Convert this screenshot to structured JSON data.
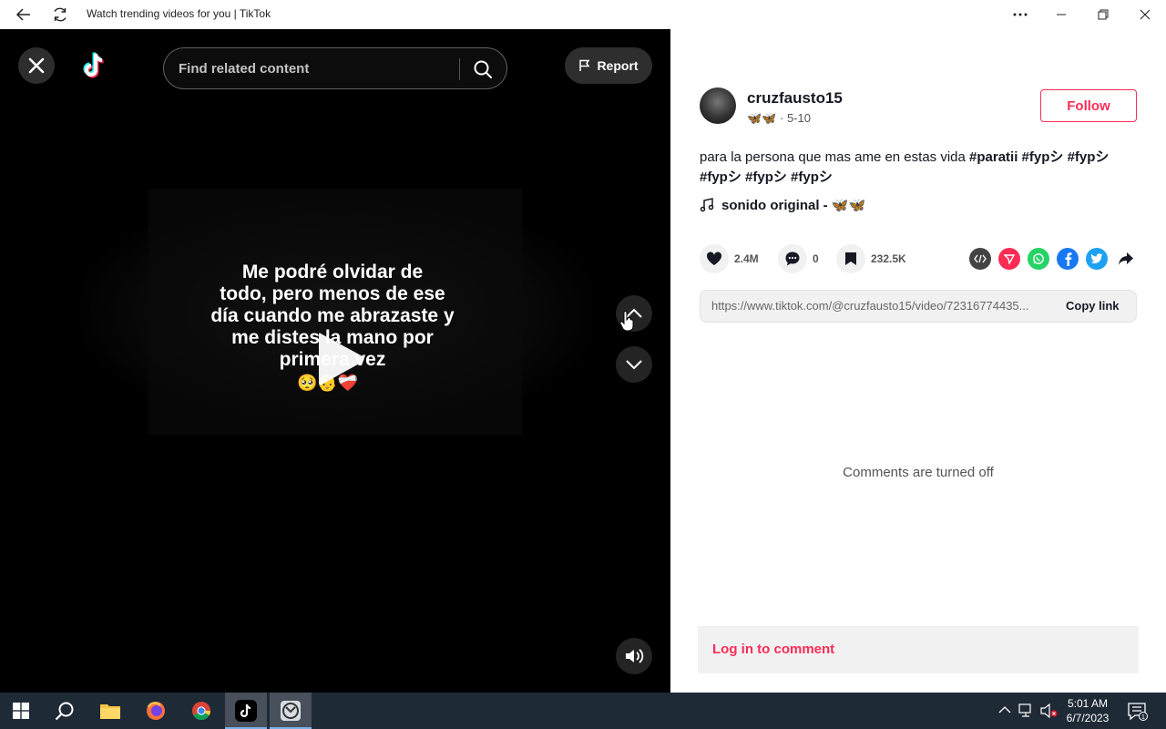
{
  "window": {
    "title": "Watch trending videos for you | TikTok"
  },
  "video": {
    "search_placeholder": "Find related content",
    "report_label": "Report",
    "caption_lines": [
      "Me podré olvidar de",
      "todo, pero menos de ese",
      "día cuando me abrazaste y",
      "me distes la mano por",
      "primera vez"
    ],
    "caption_emoji": "🥺👶❤️‍🩹"
  },
  "author": {
    "username": "cruzfausto15",
    "nickname_emoji": "🦋🦋",
    "date": "5-10",
    "follow_label": "Follow"
  },
  "post": {
    "description": "para la persona que mas ame en estas vida",
    "hashtags": [
      "#paratii",
      "#fypシ",
      "#fypシ",
      "#fypシ",
      "#fypシ",
      "#fypシ"
    ],
    "music": "sonido original - 🦋🦋"
  },
  "stats": {
    "likes": "2.4M",
    "comments": "0",
    "saves": "232.5K"
  },
  "share": {
    "url": "https://www.tiktok.com/@cruzfausto15/video/72316774435...",
    "copy_label": "Copy link"
  },
  "comments": {
    "status": "Comments are turned off",
    "login_label": "Log in to comment"
  },
  "taskbar": {
    "time": "5:01 AM",
    "date": "6/7/2023",
    "notification_count": "1"
  },
  "colors": {
    "accent": "#fe2c55",
    "video_bg": "#000000",
    "taskbar_bg": "#1f2a37"
  }
}
